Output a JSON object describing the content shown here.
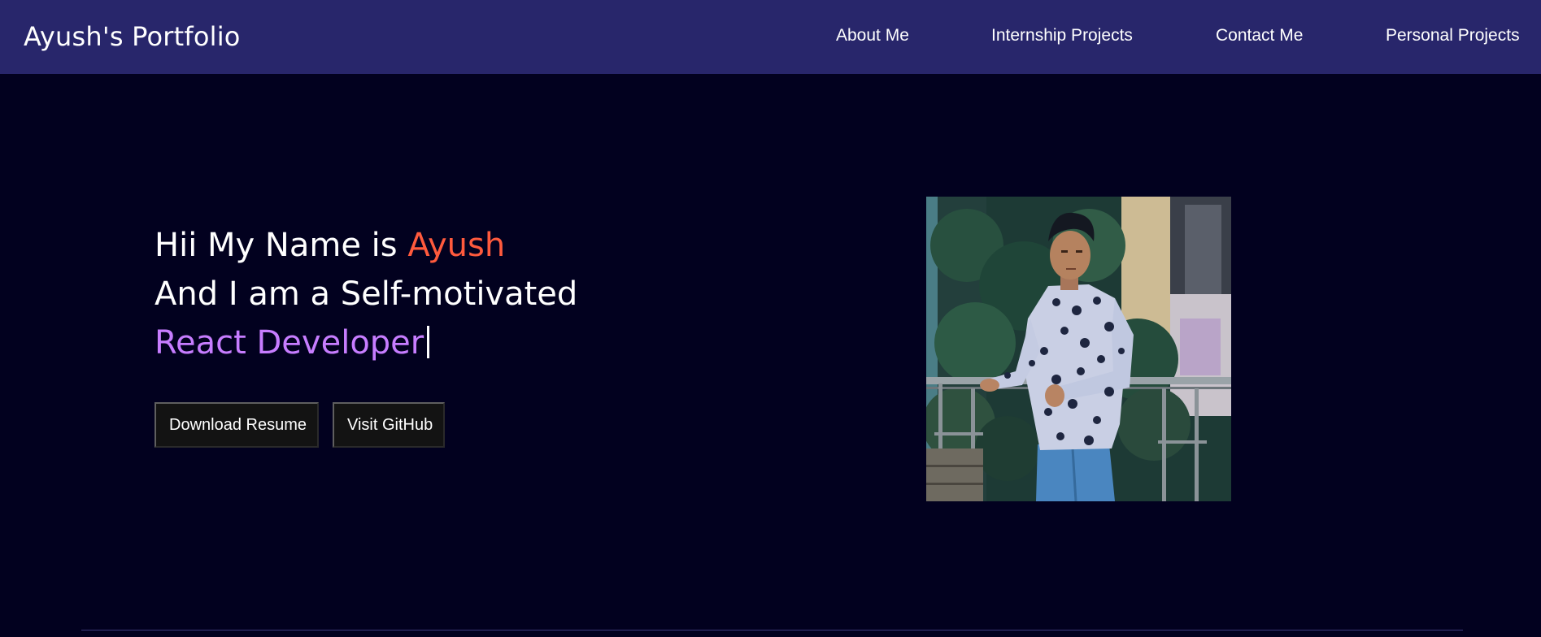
{
  "navbar": {
    "brand": "Ayush's Portfolio",
    "links": [
      "About Me",
      "Internship Projects",
      "Contact Me",
      "Personal Projects"
    ]
  },
  "hero": {
    "line1_prefix": "Hii My Name is ",
    "name": "Ayush",
    "line2": "And I am a Self-motivated",
    "role": "React Developer",
    "buttons": {
      "resume": "Download Resume",
      "github": "Visit GitHub"
    }
  },
  "colors": {
    "navbar_bg": "#28266b",
    "page_bg": "#02011f",
    "name_accent": "#ff5a3d",
    "role_accent": "#c77dff",
    "button_bg": "#131313"
  }
}
